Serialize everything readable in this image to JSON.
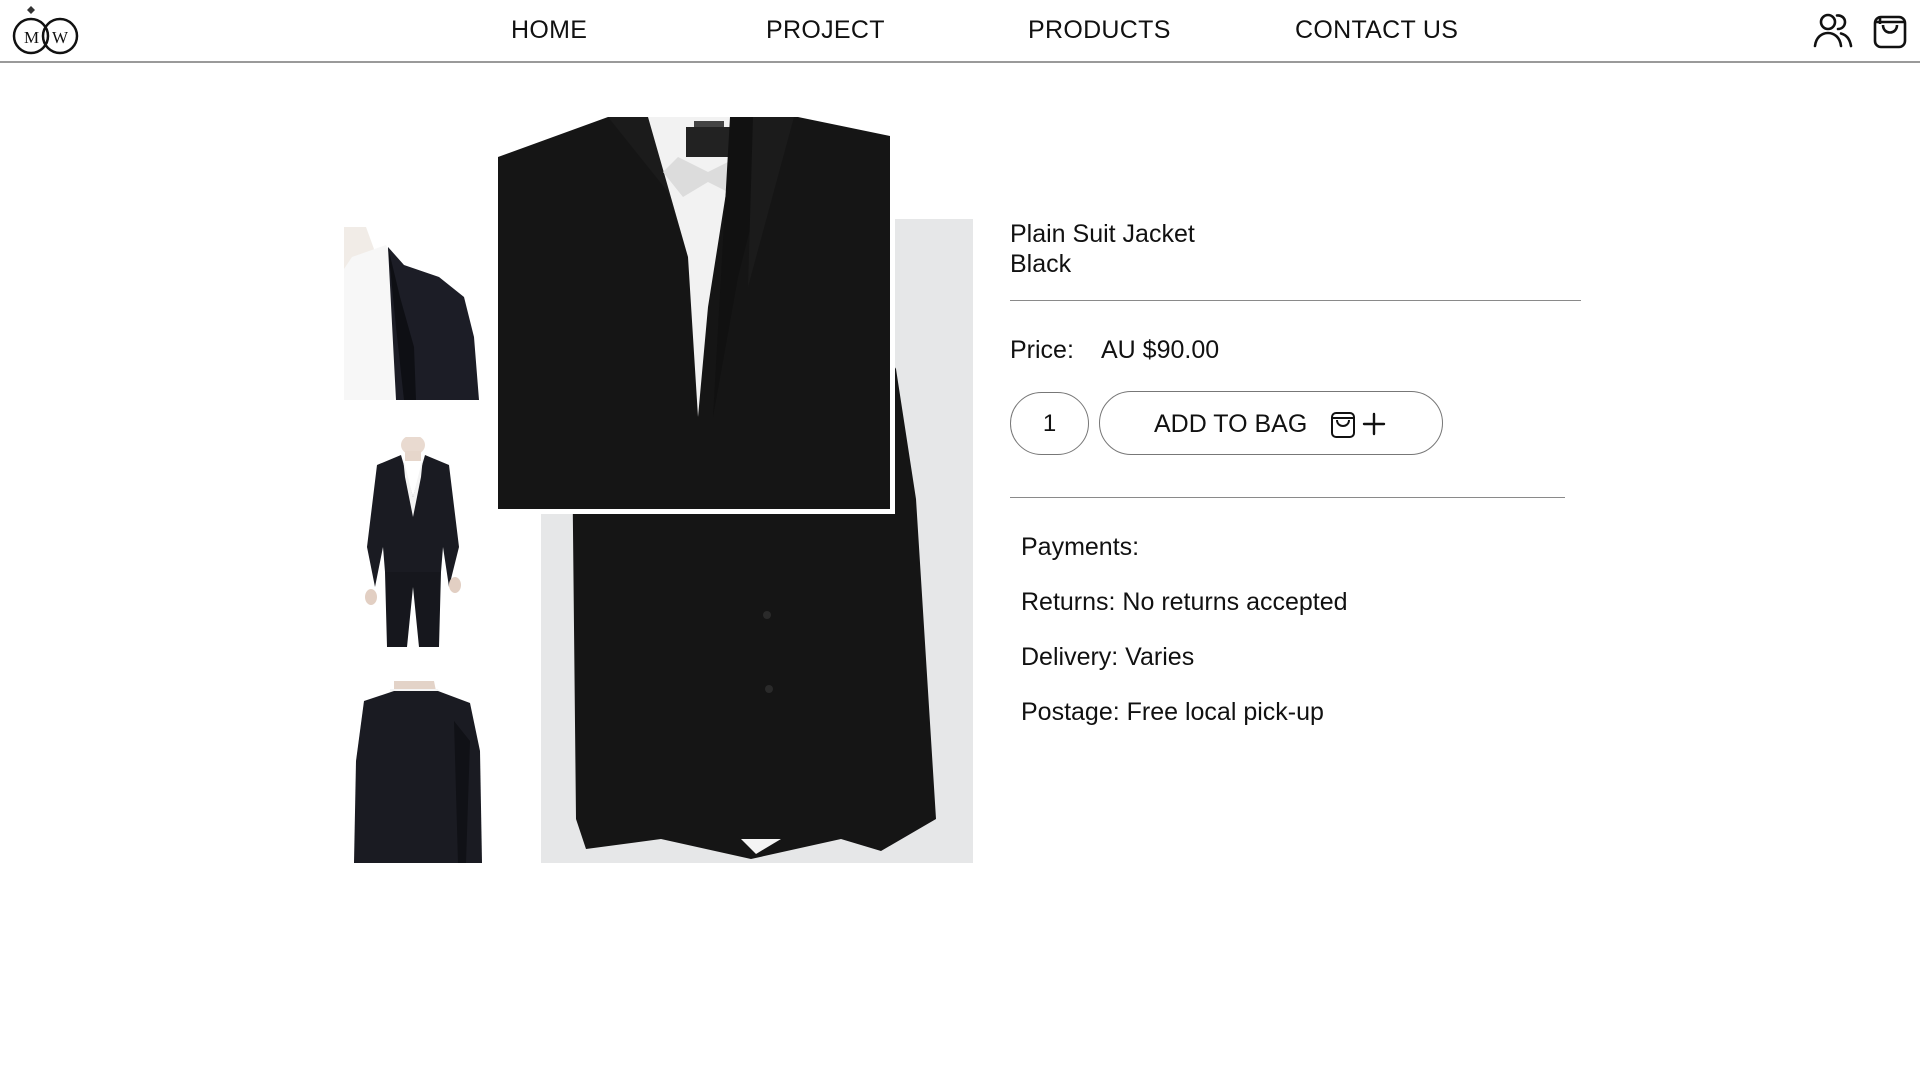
{
  "brand": {
    "logo_letter_left": "M",
    "logo_letter_right": "W"
  },
  "nav": {
    "items": [
      {
        "label": "HOME"
      },
      {
        "label": "PROJECT"
      },
      {
        "label": "PRODUCTS"
      },
      {
        "label": "CONTACT US"
      }
    ]
  },
  "header_icons": [
    "account-icon",
    "shopping-bag-icon"
  ],
  "gallery": {
    "thumbnails": [
      "jacket-shoulder-detail",
      "full-three-piece-suit",
      "jacket-back-view"
    ],
    "main_image": "plain-suit-jacket-front",
    "zoom_view": "collar-zoom"
  },
  "product": {
    "name": "Plain Suit Jacket",
    "color": "Black",
    "price_label": "Price:",
    "price": "AU $90.00",
    "quantity": "1",
    "add_to_bag_label": "ADD TO BAG"
  },
  "details": {
    "payments": "Payments:",
    "returns": "Returns: No returns accepted",
    "delivery": "Delivery: Varies",
    "postage": "Postage: Free local pick-up"
  },
  "colors": {
    "text": "#111111",
    "divider": "#8a8a8a",
    "jacket": "#151515",
    "background": "#ffffff"
  }
}
